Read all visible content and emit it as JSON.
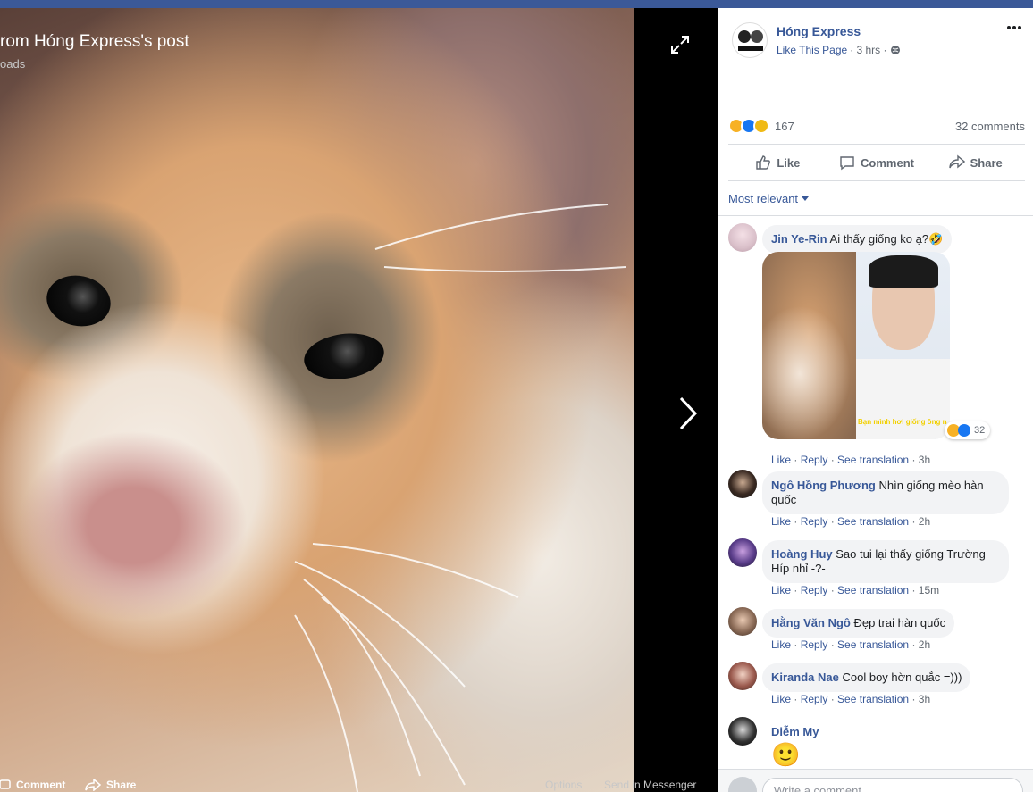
{
  "viewer": {
    "title": "rom Hóng Express's post",
    "subtitle": "oads",
    "bottom": {
      "comment_label": "Comment",
      "share_label": "Share",
      "options_label": "Options",
      "messenger_label": "Send in Messenger"
    }
  },
  "post": {
    "page_name": "Hóng Express",
    "like_page": "Like This Page",
    "time": "· 3 hrs ·",
    "reaction_count": "167",
    "comments_count": "32 comments",
    "actions": {
      "like": "Like",
      "comment": "Comment",
      "share": "Share"
    },
    "sort_label": "Most relevant",
    "image_caption": "Bạn mình hơi giống ông này"
  },
  "comments": [
    {
      "author": "Jin Ye-Rin",
      "text": "Ai thấy giống ko ạ?🤣",
      "like": "Like",
      "reply": "Reply",
      "translate": "See translation",
      "time": "3h",
      "image_reactions": "32"
    },
    {
      "author": "Ngô Hồng Phương",
      "text": "Nhìn giống mèo hàn quốc",
      "like": "Like",
      "reply": "Reply",
      "translate": "See translation",
      "time": "2h"
    },
    {
      "author": "Hoàng Huy",
      "text": "Sao tui lại thấy giống Trường Híp nhỉ -?-",
      "like": "Like",
      "reply": "Reply",
      "translate": "See translation",
      "time": "15m"
    },
    {
      "author": "Hằng Văn Ngô",
      "text": "Đẹp trai hàn quốc",
      "like": "Like",
      "reply": "Reply",
      "translate": "See translation",
      "time": "2h"
    },
    {
      "author": "Kiranda Nae",
      "text": "Cool boy hờn quắc =)))",
      "like": "Like",
      "reply": "Reply",
      "translate": "See translation",
      "time": "3h"
    },
    {
      "author": "Diễm My",
      "text": "🙂"
    }
  ],
  "composer": {
    "placeholder": "Write a comment..."
  },
  "colors": {
    "link": "#385898",
    "brand": "#3b5998",
    "bubble": "#f2f3f5"
  }
}
